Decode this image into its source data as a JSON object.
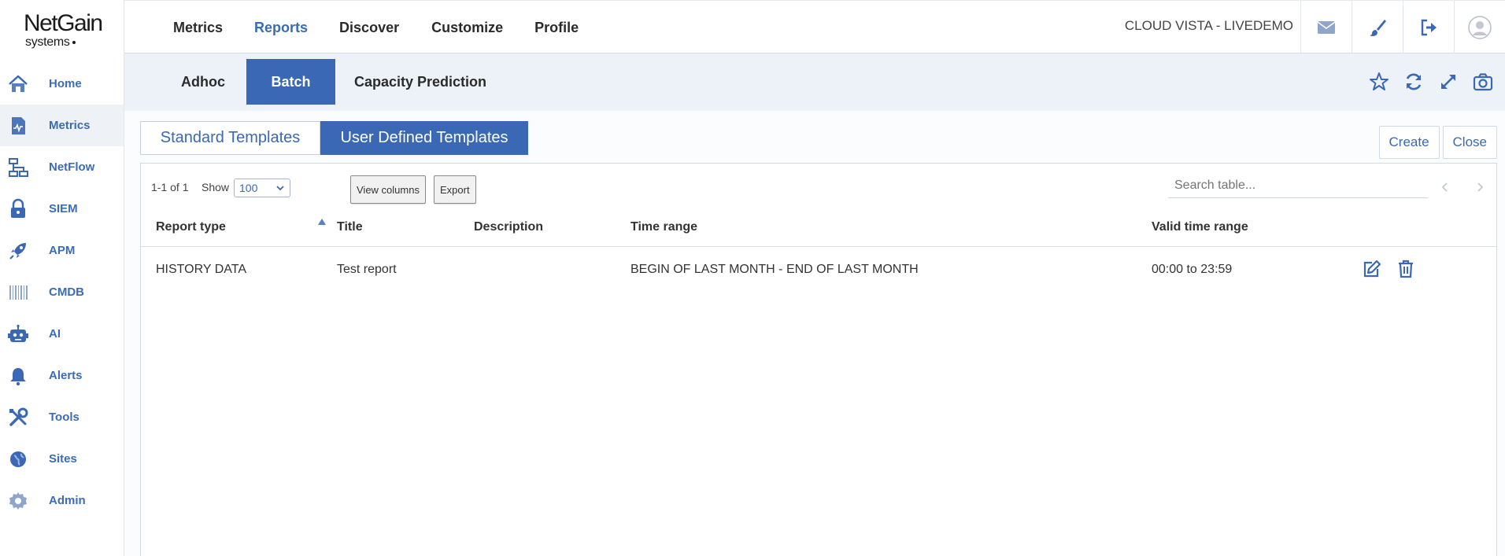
{
  "brand": {
    "name": "NetGain",
    "sub": "systems"
  },
  "sidebar": {
    "items": [
      {
        "label": "Home",
        "icon": "home-icon"
      },
      {
        "label": "Metrics",
        "icon": "metrics-icon",
        "active": true
      },
      {
        "label": "NetFlow",
        "icon": "netflow-icon"
      },
      {
        "label": "SIEM",
        "icon": "lock-icon"
      },
      {
        "label": "APM",
        "icon": "rocket-icon"
      },
      {
        "label": "CMDB",
        "icon": "barcode-icon"
      },
      {
        "label": "AI",
        "icon": "robot-icon"
      },
      {
        "label": "Alerts",
        "icon": "bell-icon"
      },
      {
        "label": "Tools",
        "icon": "tools-icon"
      },
      {
        "label": "Sites",
        "icon": "globe-icon"
      },
      {
        "label": "Admin",
        "icon": "gear-icon"
      }
    ]
  },
  "topnav": {
    "tabs": [
      {
        "label": "Metrics"
      },
      {
        "label": "Reports",
        "active": true
      },
      {
        "label": "Discover"
      },
      {
        "label": "Customize"
      },
      {
        "label": "Profile"
      }
    ],
    "tenant": "CLOUD VISTA - LIVEDEMO",
    "icons": [
      "mail-icon",
      "brush-icon",
      "logout-icon",
      "user-avatar-icon"
    ]
  },
  "subnav": {
    "tabs": [
      {
        "label": "Adhoc"
      },
      {
        "label": "Batch",
        "active": true
      },
      {
        "label": "Capacity Prediction"
      }
    ],
    "icons": [
      "star-icon",
      "refresh-icon",
      "expand-icon",
      "camera-icon"
    ]
  },
  "templates": {
    "tabs": [
      {
        "label": "Standard Templates"
      },
      {
        "label": "User Defined Templates",
        "active": true
      }
    ],
    "create_label": "Create",
    "close_label": "Close"
  },
  "table_toolbar": {
    "count": "1-1 of 1",
    "show_label": "Show",
    "show_value": "100",
    "view_columns_label": "View columns",
    "export_label": "Export",
    "search_placeholder": "Search table..."
  },
  "table": {
    "columns": [
      "Report type",
      "Title",
      "Description",
      "Time range",
      "Valid time range"
    ],
    "sorted_column": "Report type",
    "rows": [
      {
        "report_type": "HISTORY DATA",
        "title": "Test report",
        "description": "",
        "time_range": "BEGIN OF LAST MONTH - END OF LAST MONTH",
        "valid_time_range": "00:00 to 23:59"
      }
    ]
  },
  "colors": {
    "accent": "#3a68b4",
    "subbar_bg": "#edf1f8"
  }
}
